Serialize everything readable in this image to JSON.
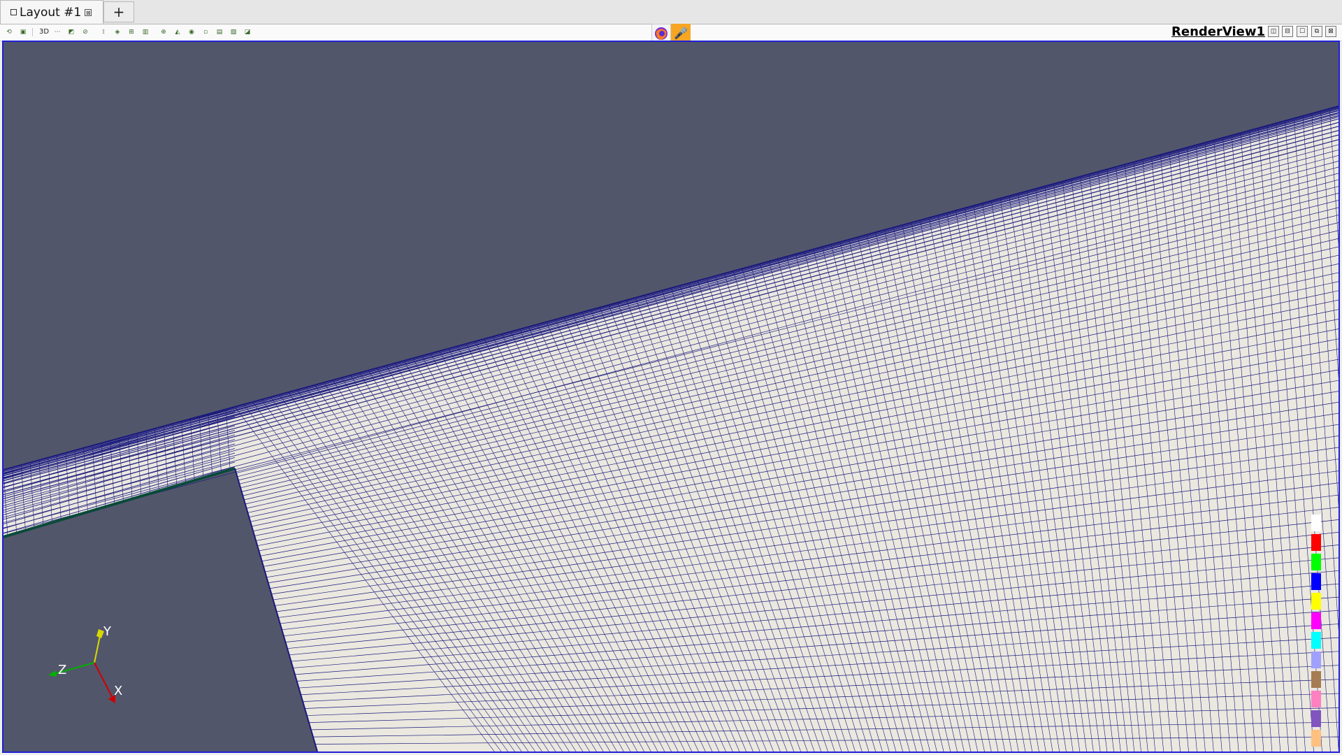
{
  "tabs": {
    "active_label": "Layout #1",
    "close": "⊠",
    "add": "+"
  },
  "toolbar": {
    "button_3d": "3D",
    "icons": [
      "reset-camera-icon",
      "select-icon",
      "camera-icon",
      "zoom-to-data-icon",
      "zoom-box-icon",
      "select-cells-icon",
      "select-points-icon",
      "select-block-icon",
      "interactive-select-icon",
      "grow-selection-icon",
      "shrink-selection-icon",
      "clear-selection-icon",
      "hover-query-icon",
      "pick-icon",
      "find-data-icon",
      "cursor-icon"
    ]
  },
  "render_view": {
    "title": "RenderView1"
  },
  "axes": {
    "x": "X",
    "y": "Y",
    "z": "Z"
  },
  "legend_colors": [
    "#ffffff",
    "#ff0000",
    "#00ff00",
    "#0000ff",
    "#ffff00",
    "#ff00ff",
    "#00ffff",
    "#a0a0ff",
    "#a67c52",
    "#ff80c0",
    "#8055c0",
    "#ffc080"
  ],
  "colors": {
    "background": "#52566b",
    "mesh_fill": "#ebe8e0",
    "mesh_line": "#1a1a7a",
    "frame": "#1f1fd6"
  }
}
